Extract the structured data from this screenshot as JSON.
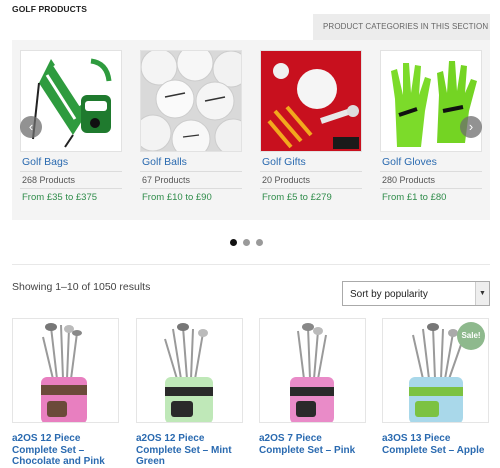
{
  "header": {
    "section_title": "GOLF PRODUCTS",
    "categories_tab": "PRODUCT CATEGORIES IN THIS SECTION"
  },
  "categories": [
    {
      "name": "Golf Bags",
      "count": "268 Products",
      "price_from": "£35",
      "price_to": "£375",
      "icon": "golf-bag-image"
    },
    {
      "name": "Golf Balls",
      "count": "67 Products",
      "price_from": "£10",
      "price_to": "£90",
      "icon": "golf-balls-image"
    },
    {
      "name": "Golf Gifts",
      "count": "20 Products",
      "price_from": "£5",
      "price_to": "£279",
      "icon": "golf-gifts-image"
    },
    {
      "name": "Golf Gloves",
      "count": "280 Products",
      "price_from": "£1",
      "price_to": "£80",
      "icon": "golf-gloves-image"
    }
  ],
  "price_words": {
    "from": "From",
    "to": "to"
  },
  "carousel": {
    "prev_icon": "‹",
    "next_icon": "›",
    "dots": 3,
    "active_dot": 0
  },
  "listing": {
    "results_text": "Showing 1–10 of 1050 results",
    "sort_selected": "Sort by popularity"
  },
  "products": [
    {
      "title": "a2OS 12 Piece Complete Set – Chocolate and Pink",
      "bag_color": "#e87fc0",
      "accent": "#6b4a3a",
      "sale": ""
    },
    {
      "title": "a2OS 12 Piece Complete Set – Mint Green",
      "bag_color": "#bfe8b8",
      "accent": "#2a2a2a",
      "sale": ""
    },
    {
      "title": "a2OS 7 Piece Complete Set – Pink",
      "bag_color": "#e98bc8",
      "accent": "#2a2a2a",
      "sale": ""
    },
    {
      "title": "a3OS 13 Piece Complete Set – Apple",
      "bag_color": "#a9d8ea",
      "accent": "#7cc242",
      "sale": "Sale!"
    }
  ],
  "colors": {
    "link": "#2a6ab0",
    "price": "#2f8c4a",
    "sale_badge": "#8eb98d"
  }
}
